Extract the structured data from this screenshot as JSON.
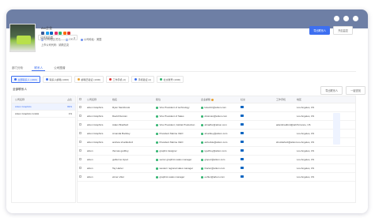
{
  "header": {
    "company_name": "Arc企业",
    "phone_label": "公司电话",
    "phone_value": "暂无",
    "employees": "100人",
    "address": "公司地址：美国",
    "ticker": "上市公司代码：纳斯达克",
    "primary_button": "导出联系人",
    "secondary_button": "开启监控",
    "select_value": "请选择范围"
  },
  "tabs": [
    "部门分析",
    "联系人",
    "公司图谱"
  ],
  "filters": [
    "全部联系人 (1000)",
    "联系人邮箱 (1000)",
    "邮箱已验证 (1000)",
    "工作手机 (2)",
    "手机验证 (2)",
    "社交账号 (1000)"
  ],
  "section": {
    "title": "全部联系人",
    "action_export": "导出联系人",
    "action_find": "一键查找"
  },
  "left_list": {
    "header_name": "公司名称",
    "header_count": "占比",
    "rows": [
      {
        "name": "Arkon Graphics",
        "count": "99%"
      },
      {
        "name": "Arkon Graphics GmbH",
        "count": "1%"
      }
    ]
  },
  "table": {
    "headers": [
      "",
      "公司名称",
      "姓名",
      "职位",
      "企业邮箱",
      "社交",
      "工作手机",
      "地区"
    ],
    "rows": [
      {
        "company": "arkon Graphics",
        "name": "Ryan Steinbrook",
        "title": "Vice President of technology",
        "email": "ksteinbr@arkon.com",
        "phone": "",
        "region": "Los Angeles, US"
      },
      {
        "company": "arkon Graphics",
        "name": "David Duncan",
        "title": "Vice President of Sales",
        "email": "dduncan@arkon.com",
        "phone": "",
        "region": "Los Angeles, US"
      },
      {
        "company": "arkon Graphics",
        "name": "Adam Bradford",
        "title": "Vice President, Global Production",
        "email": "abradfor@arkon.com",
        "phone": "adambradford@arkon.com",
        "region": "Torrance, US"
      },
      {
        "company": "arkon Graphics",
        "name": "Amanda Buckley",
        "title": "President Marine CEO",
        "email": "abuckley@arkon.com",
        "phone": "",
        "region": "Los Angeles, US"
      },
      {
        "company": "arkon Graphics",
        "name": "andrew shuckleford",
        "title": "President Marine CEO",
        "email": "ashuckle@arkon.com",
        "phone": "shuckleford@arkon.com",
        "region": "Los Angeles, US"
      },
      {
        "company": "arkon",
        "name": "thomas godfrey",
        "title": "graphic designer",
        "email": "tgodfrey@arkon.com",
        "phone": "",
        "region": "Los Angeles, US"
      },
      {
        "company": "arkon",
        "name": "guillermo lopez",
        "title": "senior graphics sales manager",
        "email": "glopez@arkon.com",
        "phone": "",
        "region": "Los Angeles, US"
      },
      {
        "company": "arkon",
        "name": "Tay Harter",
        "title": "western regional sales manager",
        "email": "tharter@arkon.com",
        "phone": "",
        "region": "Los Angeles, US"
      },
      {
        "company": "arkon",
        "name": "elmer uhler",
        "title": "graphics sales manager",
        "email": "euhler@arkon.com",
        "phone": "",
        "region": "Los Angeles, US"
      }
    ]
  },
  "colors": {
    "accent": "#3d6ff0",
    "titlebar": "#6e7fa5"
  }
}
